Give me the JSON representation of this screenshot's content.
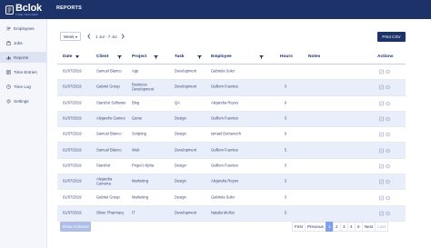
{
  "app": {
    "logo_text": "Bclok",
    "logo_sub": "TIME TRACKER",
    "page_title": "REPORTS"
  },
  "sidebar": {
    "items": [
      {
        "label": "Employees",
        "icon": "users-icon"
      },
      {
        "label": "Jobs",
        "icon": "briefcase-icon"
      },
      {
        "label": "Reports",
        "icon": "chart-icon",
        "active": true
      },
      {
        "label": "Time Entries",
        "icon": "list-icon"
      },
      {
        "label": "Time Log",
        "icon": "clock-icon"
      },
      {
        "label": "Settings",
        "icon": "gear-icon"
      }
    ]
  },
  "filters": {
    "period": "Week",
    "range": "1 Jul - 7 Jul"
  },
  "toolbar": {
    "print_label": "Print CSV"
  },
  "table": {
    "headers": {
      "date": "Date",
      "client": "Client",
      "project": "Project",
      "task": "Task",
      "employee": "Employee",
      "hours": "Hours",
      "notes": "Notes",
      "actions": "Actions"
    },
    "rows": [
      {
        "date": "01/07/2019",
        "client": "Samuel Blanco",
        "project": "App",
        "task": "Development",
        "employee": "Gabriela Soler",
        "hours": "",
        "notes": ""
      },
      {
        "date": "01/07/2019",
        "client": "Gabriel Group",
        "project": "Business Development",
        "task": "Development",
        "employee": "Guillem Fuentes",
        "hours": "3",
        "notes": ""
      },
      {
        "date": "01/07/2019",
        "client": "Starshot Software",
        "project": "Blog",
        "task": "QA",
        "employee": "Alejandra Reyes",
        "hours": "6",
        "notes": ""
      },
      {
        "date": "01/07/2019",
        "client": "Alejandro Games",
        "project": "Game",
        "task": "Design",
        "employee": "Guillem Fuentes",
        "hours": "3",
        "notes": ""
      },
      {
        "date": "01/07/2019",
        "client": "Samuel Blanco",
        "project": "Scripting",
        "task": "Design",
        "employee": "Ismael Domenech",
        "hours": "6",
        "notes": ""
      },
      {
        "date": "01/07/2019",
        "client": "Samuel Blanco",
        "project": "Web",
        "task": "Development",
        "employee": "Guillem Fuentes",
        "hours": "5",
        "notes": ""
      },
      {
        "date": "01/07/2019",
        "client": "Starshot",
        "project": "Project Alpha",
        "task": "Design",
        "employee": "Guillem Fuentes",
        "hours": "3",
        "notes": ""
      },
      {
        "date": "01/07/2019",
        "client": "Alejandra Camorra",
        "project": "Marketing",
        "task": "Design",
        "employee": "Alejandra Reyes",
        "hours": "3",
        "notes": ""
      },
      {
        "date": "01/07/2019",
        "client": "Gabriel Group",
        "project": "Marketing",
        "task": "Design",
        "employee": "Gabriela Soler",
        "hours": "3",
        "notes": ""
      },
      {
        "date": "01/07/2019",
        "client": "Oliver Pharmacy",
        "project": "IT",
        "task": "Development",
        "employee": "Natalia Muñoz",
        "hours": "5",
        "notes": ""
      }
    ]
  },
  "footer": {
    "show_archived_label": "Show Archived",
    "pagination": {
      "first": "First",
      "previous": "Previous",
      "pages": [
        "1",
        "2",
        "3",
        "4",
        "5"
      ],
      "current": "1",
      "next": "Next",
      "last": "Last"
    }
  },
  "colors": {
    "brand": "#1d3268",
    "row_alt": "#e9eefb",
    "accent": "#7fa1ea"
  }
}
